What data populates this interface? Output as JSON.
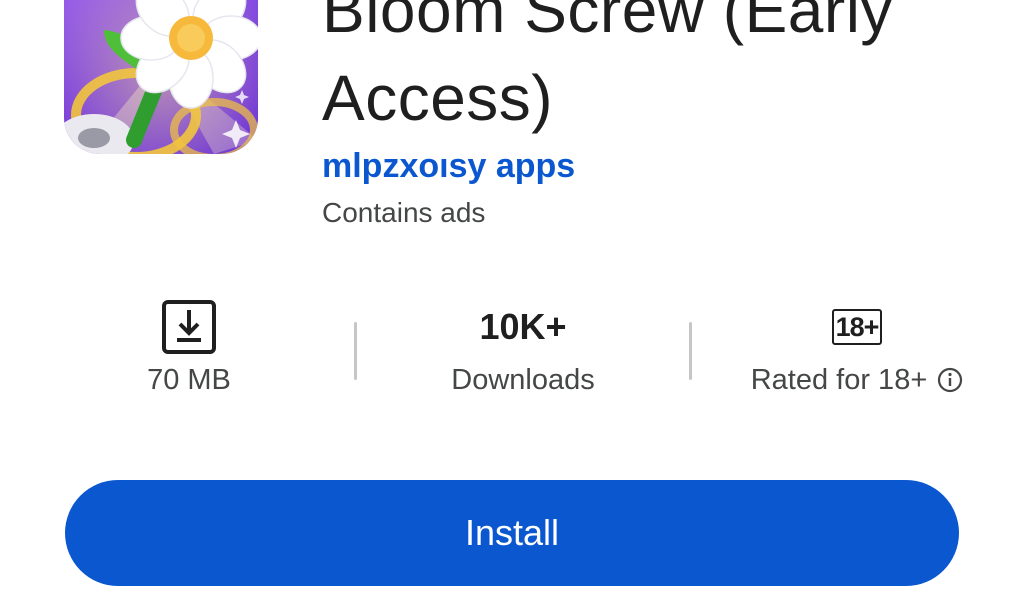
{
  "app": {
    "title": "Bloom Screw (Early Access)",
    "developer": "mlpzxoısy apps",
    "ads_notice": "Contains ads",
    "icon": "daisy-flower-app-icon"
  },
  "stats": {
    "size": {
      "icon": "download-icon",
      "label": "70 MB"
    },
    "downloads": {
      "value": "10K+",
      "label": "Downloads"
    },
    "rating": {
      "badge": "18+",
      "label": "Rated for 18+",
      "info_icon": "info-icon"
    }
  },
  "actions": {
    "install_label": "Install"
  },
  "colors": {
    "accent": "#0b57d0",
    "text_primary": "#1f1f1f",
    "text_secondary": "#444746",
    "divider": "#c4c7c5"
  }
}
